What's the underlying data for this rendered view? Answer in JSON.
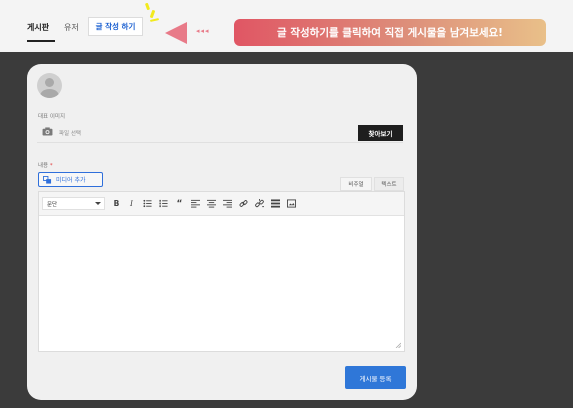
{
  "topbar": {
    "tabs": [
      {
        "label": "게시판"
      },
      {
        "label": "유저"
      }
    ],
    "write_button": "글 작성 하기",
    "callout_arrows": "◂◂◂",
    "callout_text": "글 작성하기를 클릭하여 직접 게시물을 남겨보세요!"
  },
  "form": {
    "thumbnail_label": "대표 이미지",
    "file_placeholder": "파일 선택",
    "browse_button": "찾아보기",
    "content_label": "내용",
    "required_mark": "*",
    "add_media": "미디어 추가",
    "mode_visual": "비주얼",
    "mode_text": "텍스트",
    "format_select": "문단",
    "submit_button": "게시물 등록"
  },
  "toolbar_icons": [
    "bold-icon",
    "italic-icon",
    "bullet-list-icon",
    "numbered-list-icon",
    "blockquote-icon",
    "align-left-icon",
    "align-center-icon",
    "align-right-icon",
    "link-icon",
    "unlink-icon",
    "toolbar-toggle-icon",
    "fullscreen-icon"
  ],
  "colors": {
    "accent": "#2f77d8",
    "callout_start": "#e05664",
    "callout_end": "#e9c089",
    "spark": "#f2ea1c"
  }
}
